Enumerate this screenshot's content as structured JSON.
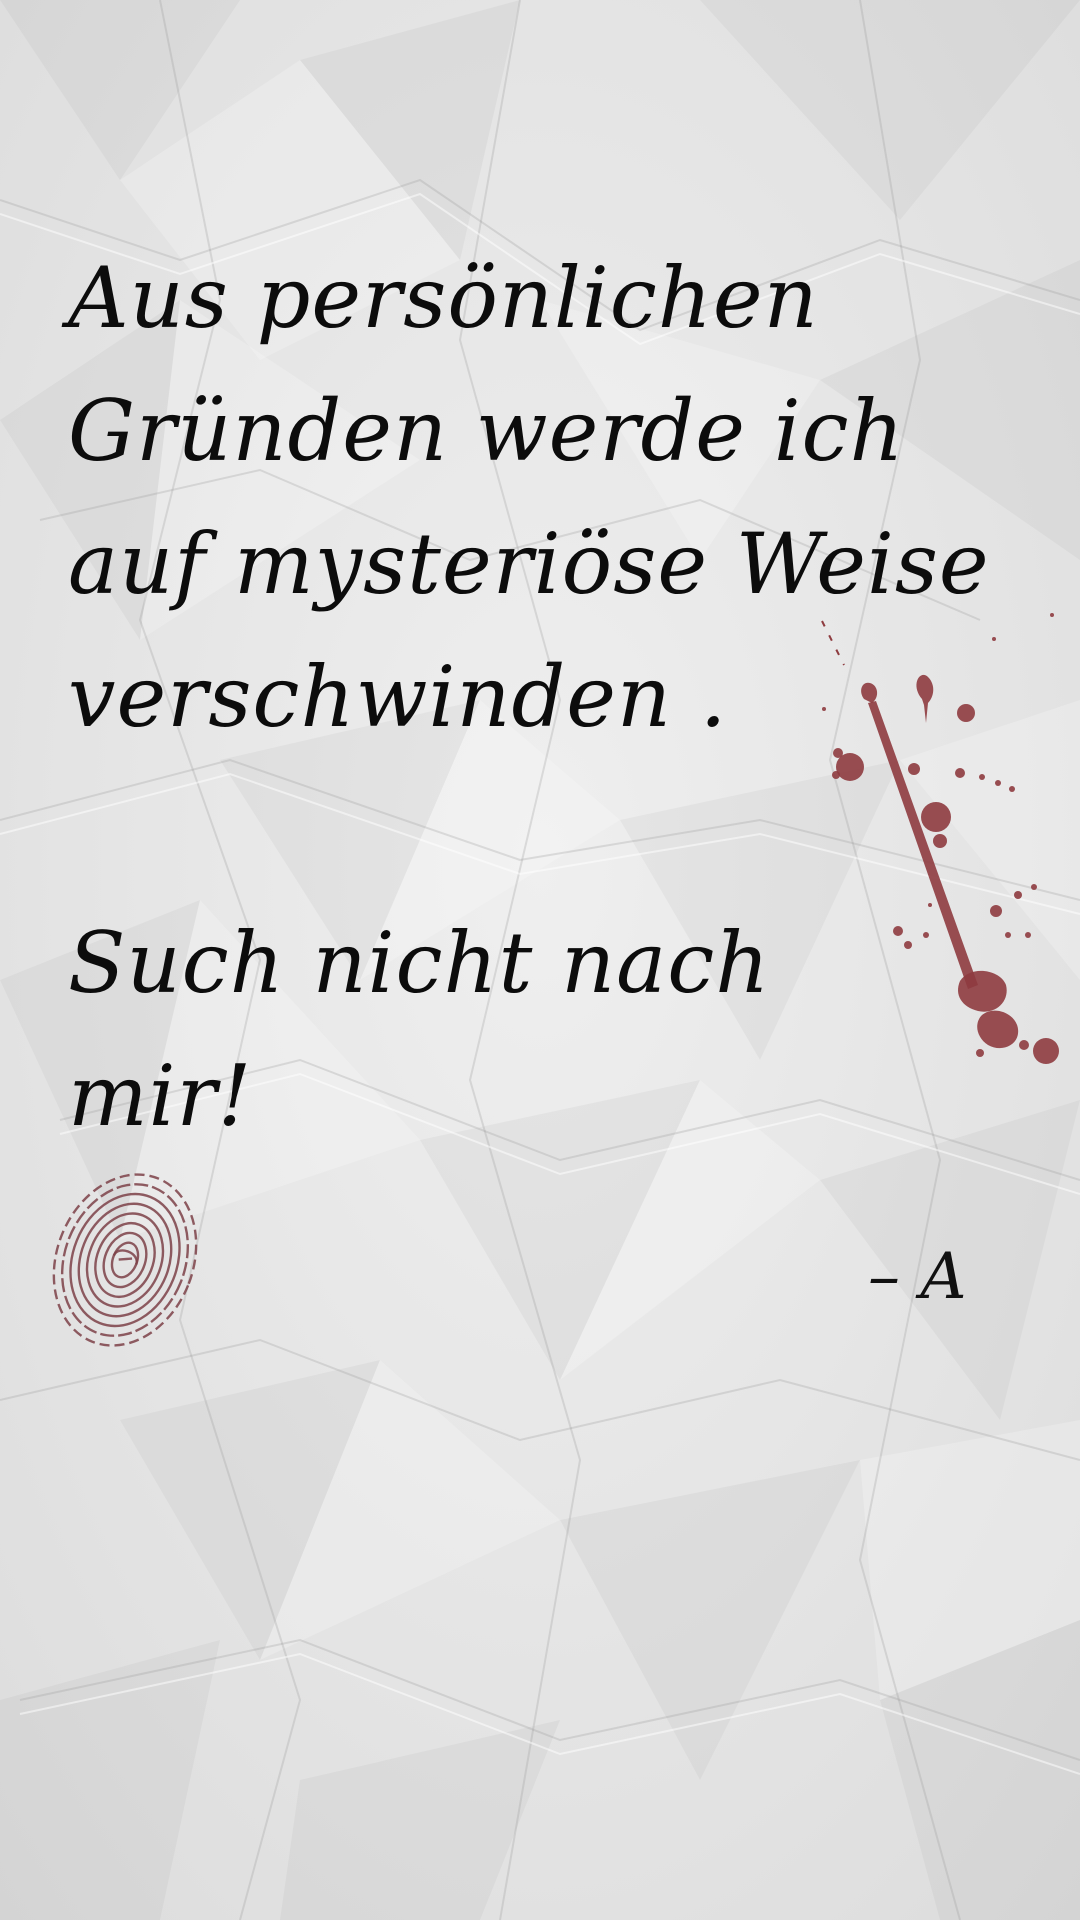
{
  "note": {
    "lines": [
      "Aus persönlichen",
      "Gründen werde ich",
      "auf mysteriöse Weise",
      "verschwinden .",
      "Such nicht nach",
      "mir!"
    ],
    "signature": "– A"
  },
  "colors": {
    "paper": "#e7e7e7",
    "ink": "#0c0c0c",
    "blood": "#8e3b3f",
    "fingerprint": "#7d4148"
  },
  "icons": {
    "splatter": "blood-splatter-icon",
    "fingerprint": "fingerprint-icon"
  }
}
